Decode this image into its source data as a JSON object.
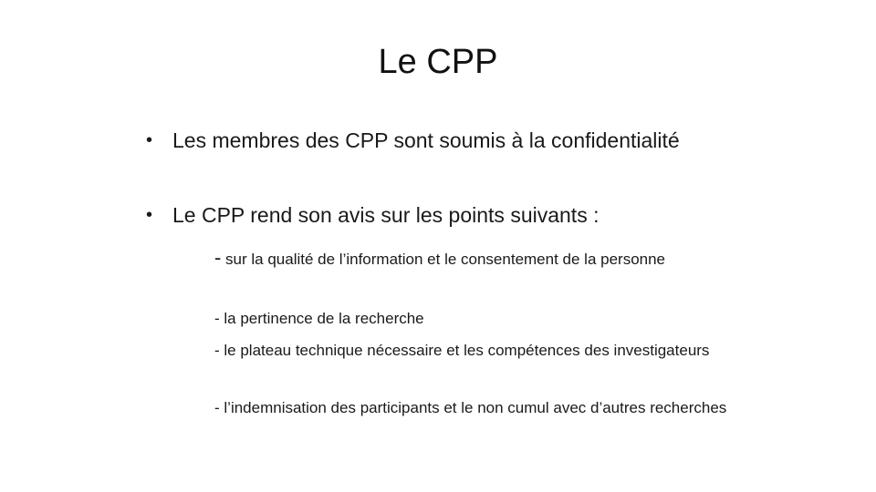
{
  "slide": {
    "title": "Le CPP",
    "bullets": [
      {
        "marker": "•",
        "text": "Les membres des CPP sont soumis à la confidentialité"
      },
      {
        "marker": "•",
        "text": "Le CPP rend son avis sur les points suivants :"
      }
    ],
    "sub_items": [
      {
        "dash": "-",
        "text": " sur la qualité de l’information et le consentement de la personne"
      },
      {
        "text": "- la pertinence de la recherche"
      },
      {
        "text": "- le plateau technique nécessaire et les compétences des investigateurs"
      },
      {
        "text": "- l’indemnisation des participants et le non cumul avec d’autres recherches"
      }
    ]
  }
}
